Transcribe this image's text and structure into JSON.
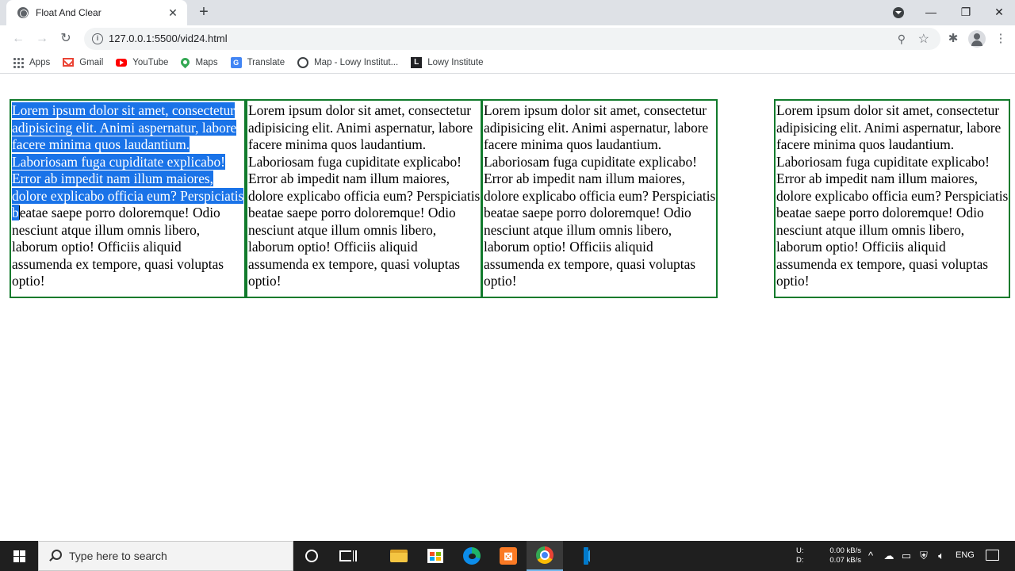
{
  "browser": {
    "tab_title": "Float And Clear",
    "tab_close": "✕",
    "new_tab": "+",
    "window": {
      "minimize": "—",
      "restore": "❐",
      "close": "✕"
    },
    "nav": {
      "back": "←",
      "forward": "→",
      "reload": "↻"
    },
    "url": "127.0.0.1:5500/vid24.html",
    "zoom_icon": "⚲",
    "star_icon": "☆",
    "extensions_icon": "✱",
    "menu_icon": "⋮"
  },
  "bookmarks": [
    {
      "label": "Apps",
      "icon": "apps-icon"
    },
    {
      "label": "Gmail",
      "icon": "gmail-icon"
    },
    {
      "label": "YouTube",
      "icon": "youtube-icon"
    },
    {
      "label": "Maps",
      "icon": "maps-icon"
    },
    {
      "label": "Translate",
      "icon": "translate-icon"
    },
    {
      "label": "Map - Lowy Institut...",
      "icon": "lowy-map-icon"
    },
    {
      "label": "Lowy Institute",
      "icon": "lowy-icon"
    }
  ],
  "page": {
    "box_border_color": "#117a2c",
    "selection_color": "#1a73e8",
    "selected_text": "Lorem ipsum dolor sit amet, consectetur adipisicing elit. Animi aspernatur, labore facere minima quos laudantium. Laboriosam fuga cupiditate explicabo! Error ab impedit nam illum maiores, dolore explicabo officia eum? Perspiciatis b",
    "after_selection_text": "eatae saepe porro doloremque! Odio nesciunt atque illum omnis libero, laborum optio! Officiis aliquid assumenda ex tempore, quasi voluptas optio!",
    "box_text": "Lorem ipsum dolor sit amet, consectetur adipisicing elit. Animi aspernatur, labore facere minima quos laudantium. Laboriosam fuga cupiditate explicabo! Error ab impedit nam illum maiores, dolore explicabo officia eum? Perspiciatis beatae saepe porro doloremque! Odio nesciunt atque illum omnis libero, laborum optio! Officiis aliquid assumenda ex tempore, quasi voluptas optio!"
  },
  "taskbar": {
    "search_placeholder": "Type here to search",
    "apps": [
      "cortana-icon",
      "task-view-icon",
      "file-explorer-icon",
      "store-icon",
      "edge-icon",
      "xampp-icon",
      "chrome-icon",
      "vscode-icon"
    ],
    "xampp_glyph": "⊠",
    "net_up_label": "U:",
    "net_down_label": "D:",
    "net_up": "0.00 kB/s",
    "net_down": "0.07 kB/s",
    "tray_chevron": "^",
    "language": "ENG"
  }
}
